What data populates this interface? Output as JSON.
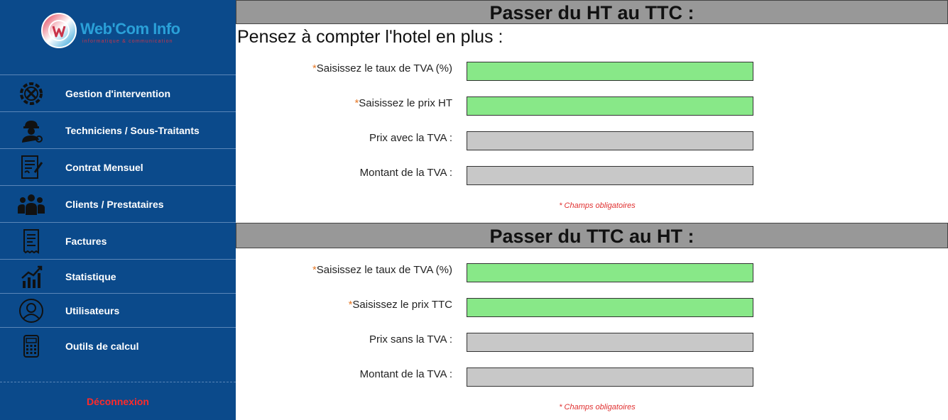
{
  "brand": {
    "name": "Web'Com Info",
    "tagline": "informatique & communication"
  },
  "sidebar": {
    "items": [
      {
        "label": "Gestion d'intervention",
        "icon": "gear-x-icon"
      },
      {
        "label": "Techniciens / Sous-Traitants",
        "icon": "technician-icon"
      },
      {
        "label": "Contrat Mensuel",
        "icon": "contract-icon"
      },
      {
        "label": "Clients / Prestataires",
        "icon": "group-icon"
      },
      {
        "label": "Factures",
        "icon": "invoice-icon"
      },
      {
        "label": "Statistique",
        "icon": "chart-icon"
      },
      {
        "label": "Utilisateurs",
        "icon": "user-icon"
      },
      {
        "label": "Outils de calcul",
        "icon": "calculator-icon"
      }
    ],
    "logout": "Déconnexion"
  },
  "ht_to_ttc": {
    "title": "Passer du HT au TTC :",
    "subtitle": "Pensez à compter l'hotel en plus :",
    "req_mark": "*",
    "rate_label": "Saisissez le taux de TVA (%)",
    "price_label": "Saisissez le prix HT",
    "result_label": "Prix avec la TVA :",
    "tva_label": "Montant de la TVA :",
    "note": "* Champs obligatoires"
  },
  "ttc_to_ht": {
    "title": "Passer du TTC au HT :",
    "req_mark": "*",
    "rate_label": "Saisissez le taux de TVA (%)",
    "price_label": "Saisissez le prix TTC",
    "result_label": "Prix sans la TVA :",
    "tva_label": "Montant de la TVA :",
    "note": "* Champs obligatoires"
  },
  "colors": {
    "sidebar_bg": "#0b4a8b",
    "input_required": "#88e888",
    "input_readonly": "#c8c8c8",
    "logout": "#ff2a2a",
    "header_bg": "#989898"
  }
}
